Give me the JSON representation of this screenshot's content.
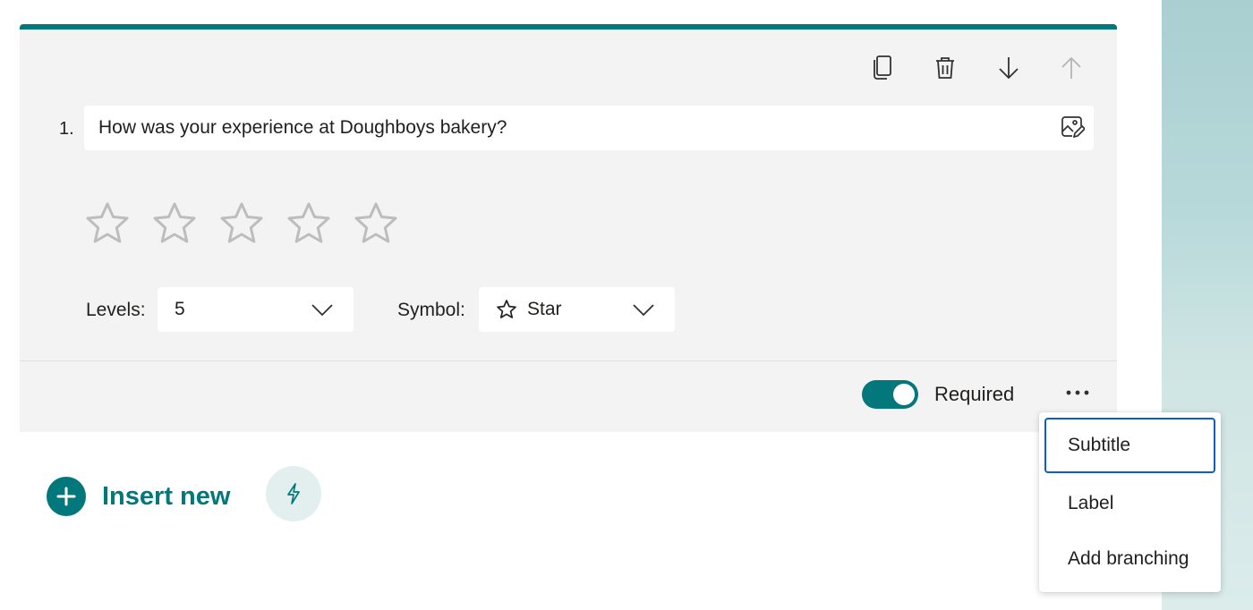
{
  "question": {
    "number": "1.",
    "title": "How was your experience at Doughboys bakery?",
    "rating_levels": 5
  },
  "toolbar": {
    "icons": [
      "copy-icon",
      "delete-icon",
      "move-down-icon",
      "move-up-icon"
    ]
  },
  "settings": {
    "levels_label": "Levels:",
    "levels_value": "5",
    "symbol_label": "Symbol:",
    "symbol_value": "Star"
  },
  "footer": {
    "required_label": "Required",
    "required_on": true,
    "more_label": "..."
  },
  "insert": {
    "label": "Insert new"
  },
  "menu": {
    "items": [
      {
        "label": "Subtitle"
      },
      {
        "label": "Label"
      },
      {
        "label": "Add branching"
      }
    ]
  },
  "colors": {
    "accent": "#03787c",
    "focus": "#0f5ec7"
  }
}
